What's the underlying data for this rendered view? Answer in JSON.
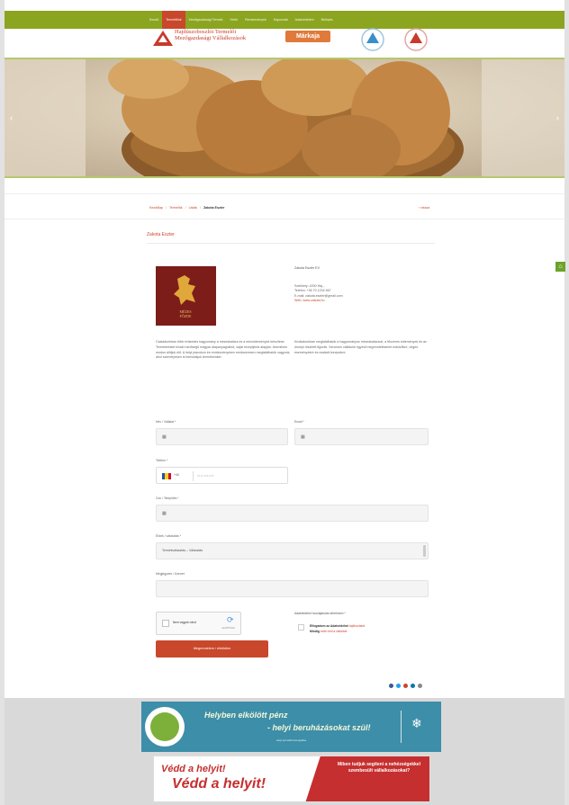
{
  "nav": {
    "items": [
      {
        "label": "Kezdő"
      },
      {
        "label": "Termelőink",
        "active": true
      },
      {
        "label": "Mezőgazdasági Termék"
      },
      {
        "label": "Hírek"
      },
      {
        "label": "Rendezvények"
      },
      {
        "label": "Kapcsolat"
      },
      {
        "label": "Adatvédelem"
      },
      {
        "label": "Belépés"
      }
    ]
  },
  "header": {
    "logo_line1": "Hajdúszoboszlói Termelői",
    "logo_line2": "Mezőgazdasági Vállalkozások",
    "market_label": "Márkaja"
  },
  "breadcrumb": {
    "items": [
      "Kezdőlap",
      "Termelők",
      "Listák",
      "Zakota Eszter"
    ],
    "back": "‹ vissza"
  },
  "section_title": "Zakota Eszter",
  "company": {
    "logo_text": "MÉZES\nFŐZDE",
    "name": "Zakota Eszter EV.",
    "address": "Székhely: 4200 Haj...",
    "phone": "Telefon: +36 70 1234 567",
    "email": "E-mail: zakota.eszter@gmail.com",
    "web": "Web: www.zakota.hu"
  },
  "description": {
    "left": "Családunkban több évtizedes hagyomány a mézeskalács és a mézsütemények készítése. Termékeinket kiváló minőségű magyar alapanyagokból, saját receptjeink alapján, kézműves módon állítjuk elő. A helyi piacokon és rendezvényeken rendszeresen megtalálhatók vagyunk, ahol személyesen is bemutatjuk termékeinket.",
    "right": "Kínálatunkban megtalálhatók a hagyományos mézeskalácsok, a fűszeres sütemények és az ünnepi díszített figurák. Szívesen vállalunk egyedi megrendeléseket esküvőkre, céges eseményekre és családi ünnepekre."
  },
  "form": {
    "name_label": "Név / Vállalat *",
    "email_label": "Email *",
    "phone_label": "Telefon *",
    "phone_code": "+40",
    "phone_placeholder": "0712 345 678",
    "city_label": "Cím / Település *",
    "subject_label": "Érdek / választás *",
    "subject_value": "Termékválasztás – Választás",
    "message_label": "Megjegyzés / Üzenet",
    "captcha_text": "Nem vagyok robot",
    "captcha_brand": "reCAPTCHA",
    "submit_label": "Megrendelem / elküldöm",
    "consent_title": "Adatvédelmi hozzájárulás kérelmem *",
    "consent_line1_prefix": "Elfogadom az Adatvédelmi",
    "consent_line1_link": "tájékoztatót",
    "consent_line2_prefix": "Mindig",
    "consent_line2_link": "ezért kell a cikkeket"
  },
  "banner1": {
    "line1": "Helyben elkölött pénz",
    "line2": "- helyi beruházásokat szül!",
    "sub": "Helyi termelők támogatása"
  },
  "banner2": {
    "line1": "Védd a helyit!",
    "line2": "Védd a helyit!",
    "right": "Miben tudjuk segíteni a nehézségekkel szembesült vállalkozásokat?"
  },
  "colors": {
    "nav_green": "#8ba521",
    "accent_red": "#c9472b",
    "banner_blue": "#3d8ea8"
  }
}
